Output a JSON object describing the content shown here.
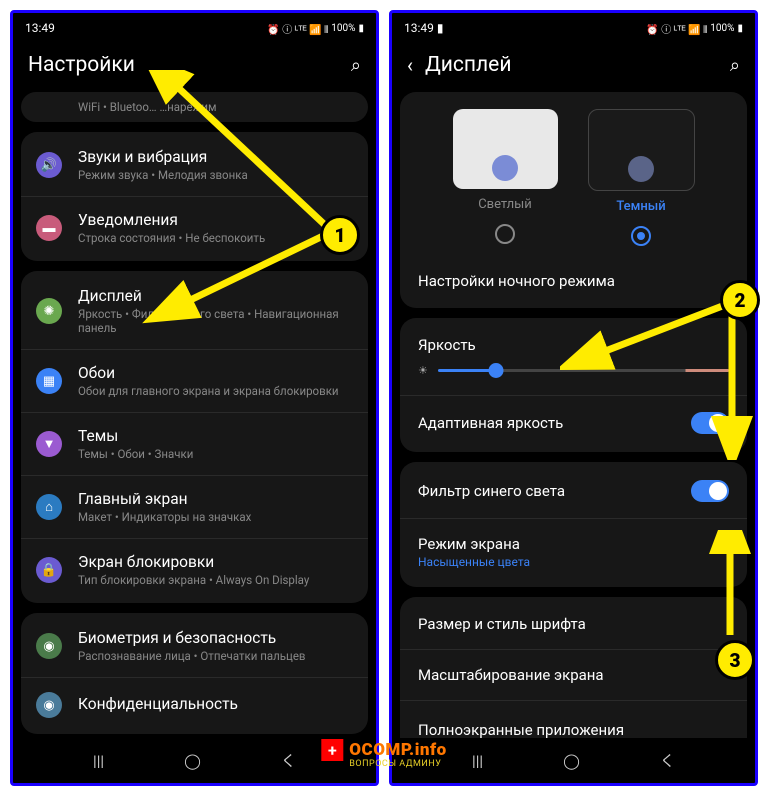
{
  "status": {
    "time": "13:49",
    "battery": "100%",
    "icons": "⏰ ⓘ ᴸᵀᴱ 📶 ⫴"
  },
  "left": {
    "title": "Настройки",
    "truncated": "WiFi  •  Bluetoo…  …нарежим",
    "items": [
      {
        "icon": "#6b5bd1",
        "glyph": "🔊",
        "title": "Звуки и вибрация",
        "sub": "Режим звука  •  Мелодия звонка"
      },
      {
        "icon": "#c85b7b",
        "glyph": "📋",
        "title": "Уведомления",
        "sub": "Строка состояния  •  Не беспокоить"
      }
    ],
    "items2": [
      {
        "icon": "#6aa84f",
        "glyph": "☀",
        "title": "Дисплей",
        "sub": "Яркость  •  Фильтр синего света  •  Навигационная панель"
      },
      {
        "icon": "#3b82f6",
        "glyph": "🖼",
        "title": "Обои",
        "sub": "Обои для главного экрана и экрана блокировки"
      },
      {
        "icon": "#9b5bd1",
        "glyph": "🎨",
        "title": "Темы",
        "sub": "Темы  •  Обои  •  Значки"
      },
      {
        "icon": "#2b7bc1",
        "glyph": "⌂",
        "title": "Главный экран",
        "sub": "Макет  •  Индикаторы на значках"
      },
      {
        "icon": "#6b5bd1",
        "glyph": "🔒",
        "title": "Экран блокировки",
        "sub": "Тип блокировки экрана  •  Always On Display"
      }
    ],
    "items3": [
      {
        "icon": "#4a7b4a",
        "glyph": "🛡",
        "title": "Биометрия и безопасность",
        "sub": "Распознавание лица  •  Отпечатки пальцев"
      },
      {
        "icon": "#4a7b9a",
        "glyph": "📍",
        "title": "Конфиденциальность",
        "sub": ""
      }
    ]
  },
  "right": {
    "title": "Дисплей",
    "theme_light": "Светлый",
    "theme_dark": "Темный",
    "night": "Настройки ночного режима",
    "brightness": "Яркость",
    "adaptive": "Адаптивная яркость",
    "bluefilter": "Фильтр синего света",
    "screenmode": "Режим экрана",
    "screenmode_sub": "Насыщенные цвета",
    "fontsize": "Размер и стиль шрифта",
    "scaling": "Масштабирование экрана",
    "fullscreen": "Полноэкранные приложения"
  },
  "watermark": {
    "text": "OCOMP.info",
    "sub": "ВОПРОСЫ АДМИНУ"
  },
  "badges": {
    "1": "1",
    "2": "2",
    "3": "3"
  }
}
